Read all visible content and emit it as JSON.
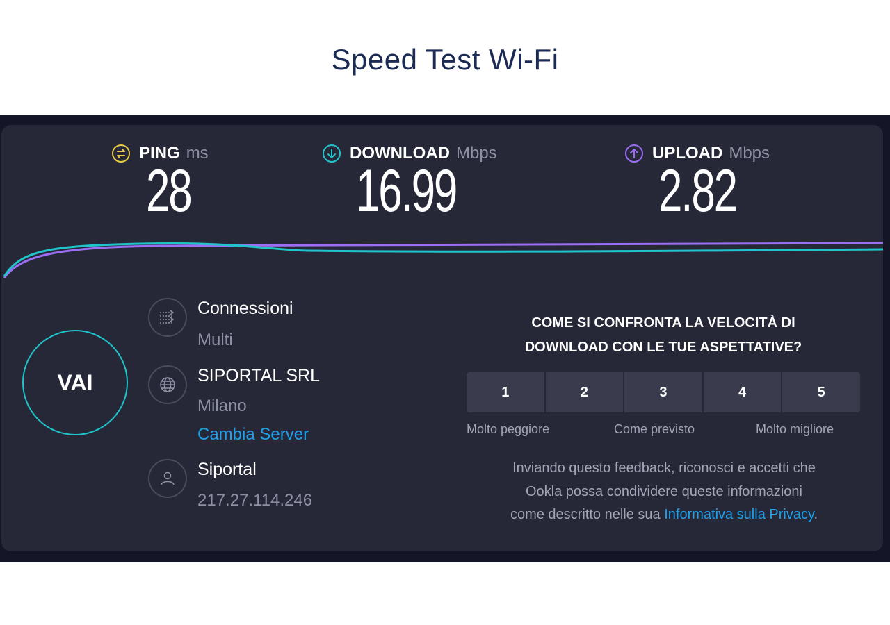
{
  "page": {
    "title": "Speed Test Wi-Fi"
  },
  "colors": {
    "background": "#ffffff",
    "frame": "#141526",
    "card": "#262838",
    "accent_cyan": "#20c4cb",
    "upload_purple": "#9b6ef3",
    "ping_yellow": "#e6cb44",
    "link_blue": "#1fa0e8"
  },
  "metrics": {
    "ping": {
      "label": "PING",
      "unit": "ms",
      "value": "28",
      "icon": "ping-icon"
    },
    "download": {
      "label": "DOWNLOAD",
      "unit": "Mbps",
      "value": "16.99",
      "icon": "download-icon"
    },
    "upload": {
      "label": "UPLOAD",
      "unit": "Mbps",
      "value": "2.82",
      "icon": "upload-icon"
    }
  },
  "go_button": {
    "label": "VAI"
  },
  "connection": {
    "title": "Connessioni",
    "value": "Multi",
    "icon": "connections-icon"
  },
  "server": {
    "name": "SIPORTAL SRL",
    "location": "Milano",
    "change_label": "Cambia Server",
    "icon": "globe-icon"
  },
  "isp": {
    "name": "Siportal",
    "ip": "217.27.114.246",
    "icon": "user-icon"
  },
  "survey": {
    "question_line1": "COME SI CONFRONTA LA VELOCITÀ DI",
    "question_line2": "DOWNLOAD CON LE TUE ASPETTATIVE?",
    "ratings": [
      "1",
      "2",
      "3",
      "4",
      "5"
    ],
    "scale_low": "Molto peggiore",
    "scale_mid": "Come previsto",
    "scale_high": "Molto migliore",
    "disclaimer_line1": "Inviando questo feedback, riconosci e accetti che",
    "disclaimer_line2": "Ookla possa condividere queste informazioni",
    "disclaimer_line3": "come descritto nelle sua ",
    "privacy_link": "Informativa sulla Privacy",
    "disclaimer_end": "."
  }
}
